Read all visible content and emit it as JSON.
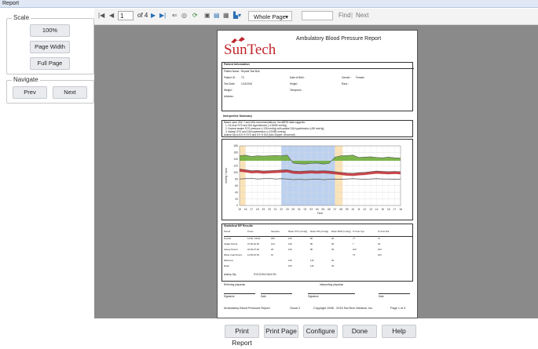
{
  "window": {
    "title": "Report"
  },
  "scale": {
    "title": "Scale",
    "btn_100": "100%",
    "btn_width": "Page Width",
    "btn_full": "Full Page"
  },
  "navigate": {
    "title": "Navigate",
    "prev": "Prev",
    "next": "Next"
  },
  "toolbar": {
    "page_value": "1",
    "page_of": "of 4",
    "zoom": "Whole Page",
    "find": "Find",
    "next": "Next"
  },
  "report": {
    "title": "Ambulatory Blood Pressure Report",
    "brand": "SunTech",
    "patient_header": "Patient Information",
    "patient_name_label": "Patient Name :",
    "patient_name": "Repeat Test Bob",
    "patient_id_label": "Patient ID :",
    "patient_id": "TC",
    "test_date_label": "Test Date :",
    "test_date": "1/14/2015",
    "dob_label": "Date of Birth :",
    "gender_label": "Gender :",
    "gender": "Female",
    "height_label": "Height :",
    "race_label": "Race :",
    "weight_label": "Weight :",
    "telephone_label": "Telephone :",
    "address_label": "Address :",
    "interp_header": "Interpretive Summary",
    "interp_lines": [
      "Based upon JNC 7 and AHA recommendations, the ABPM data suggests:",
      "1. 24-hour SYS and DIA hypertension (>130/80 mmHg)",
      "2. Normal awake SYS pressure (<135 mmHg) with awake DIA hypertension (>85 mmHg)",
      "3. Asleep SYS and DIA hypertension (>120/80 mmHg)",
      "Asleep Dip is 8.5 % SYS and 5.9 % DIA (Non-Dipper: abnormal)"
    ],
    "chart_ylabel": "mmHg / bpm",
    "chart_xlabel": "Time",
    "stats_header": "Statistical BP Results",
    "stats_cols": [
      "Period",
      "Times",
      "Samples",
      "Mean SYS (mmHg)",
      "Mean DIA (mmHg)",
      "Mean MAP (mmHg)",
      "% Over Sys",
      "% Over Dia"
    ],
    "stats_rows": [
      [
        "Overall",
        "14:56 / 09:02",
        "250",
        "130",
        "80",
        "92",
        "77",
        "71"
      ],
      [
        "Awake Period",
        "07:00-22:00",
        "124",
        "130",
        "80",
        "93",
        "7",
        "45"
      ],
      [
        "Asleep Period",
        "22:00-07:00",
        "26",
        "120",
        "80",
        "93",
        "100",
        "100"
      ],
      [
        "White Coat Period",
        "14:56-15:54",
        "10",
        "",
        "",
        "",
        "73",
        "100"
      ],
      [
        "Maximum",
        "",
        "",
        "136",
        "116",
        "93",
        "",
        ""
      ],
      [
        "Mean",
        "",
        "",
        "150",
        "116",
        "93",
        "",
        ""
      ]
    ],
    "dip_label": "Asleep Dip:",
    "dip_value": "SYS 8.5% DIA 5.9%",
    "ref_phys": "Referring physician",
    "int_phys": "Interpreting physician",
    "sig": "Signature",
    "date": "Date",
    "footer_left": "Ambulatory Blood Pressure Report",
    "footer_oscar": "Oscar 2",
    "footer_copy": "Copyright 1998 - 2015 SunTech Medical, Inc.",
    "footer_page": "Page 1 of 4"
  },
  "chart_data": {
    "type": "line",
    "x": [
      "15",
      "16",
      "17",
      "18",
      "19",
      "20",
      "21",
      "22",
      "23",
      "00",
      "01",
      "02",
      "03",
      "04",
      "05",
      "06",
      "07",
      "08",
      "09",
      "10",
      "11",
      "12",
      "13",
      "14",
      "15",
      "16",
      "17",
      "18"
    ],
    "ylim": [
      0,
      180
    ],
    "yticks": [
      "0",
      "20",
      "40",
      "60",
      "80",
      "100",
      "120",
      "140",
      "160",
      "180"
    ],
    "xlabel": "Time",
    "ylabel": "mmHg / bpm",
    "series": [
      {
        "name": "",
        "values": [
          150,
          152,
          148,
          150,
          149,
          150,
          151,
          150,
          152,
          128,
          126,
          125,
          127,
          128,
          125,
          127,
          146,
          150,
          151,
          152,
          145,
          146,
          147,
          145,
          144,
          146,
          144,
          143
        ]
      },
      {
        "name": "",
        "values": [
          110,
          108,
          105,
          106,
          104,
          105,
          106,
          107,
          108,
          104,
          103,
          104,
          105,
          104,
          105,
          104,
          102,
          100,
          98,
          97,
          99,
          100,
          102,
          104,
          103,
          102,
          103,
          102
        ]
      },
      {
        "name": "",
        "values": [
          80,
          81,
          82,
          80,
          81,
          82,
          80,
          81,
          80,
          78,
          79,
          78,
          79,
          80,
          78,
          79,
          80,
          79,
          80,
          81,
          80,
          79,
          80,
          81,
          80,
          80,
          79,
          80
        ]
      }
    ]
  },
  "bottom": {
    "print_report": "Print Report",
    "print_page": "Print Page",
    "configure": "Configure",
    "done": "Done",
    "help": "Help"
  }
}
